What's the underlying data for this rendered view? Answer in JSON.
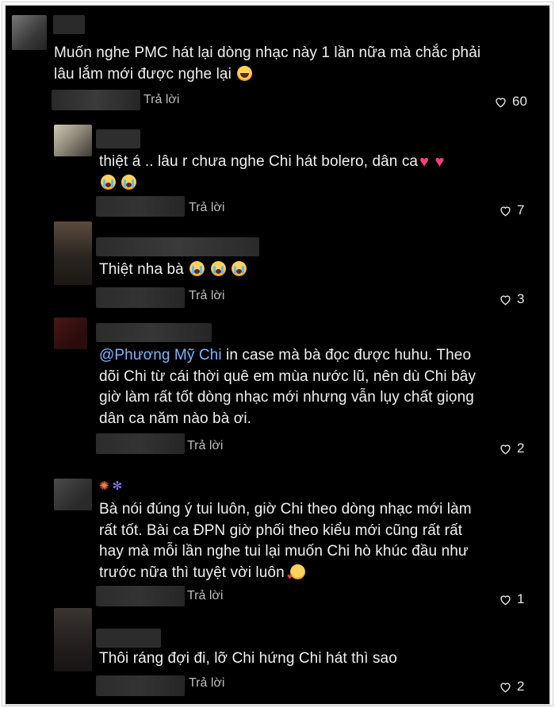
{
  "reply_label": "Trả lời",
  "comments": [
    {
      "text": "Muốn nghe PMC hát lại dòng nhạc này 1 lần nữa mà chắc phải lâu lắm mới được nghe lại",
      "likes": "60"
    },
    {
      "text": "thiệt á .. lâu r chưa nghe Chi hát bolero, dân ca",
      "likes": "7"
    },
    {
      "text": "Thiệt nha bà",
      "likes": "3"
    },
    {
      "mention": "@Phương Mỹ Chi",
      "text": " in case mà bà đọc được huhu. Theo dõi Chi từ cái thời quê em mùa nước lũ, nên dù Chi bây giờ làm rất tốt dòng nhạc mới nhưng vẫn lụy chất giọng dân ca năm nào bà ơi.",
      "likes": "2"
    },
    {
      "text": "Bà nói đúng ý tui luôn, giờ Chi theo dòng nhạc mới làm rất tốt. Bài ca ĐPN giờ phối theo kiểu mới cũng rất rất hay mà mỗi lần nghe tui lại muốn Chi hò khúc đầu như trước nữa thì tuyệt vời luôn",
      "likes": "1"
    },
    {
      "text": "Thôi ráng đợi đi, lỡ Chi hứng Chi hát thì sao",
      "likes": "2"
    }
  ],
  "icons": {
    "like": "heart-outline-icon"
  },
  "colors": {
    "mention": "#7fb3ff",
    "background": "#000000"
  }
}
